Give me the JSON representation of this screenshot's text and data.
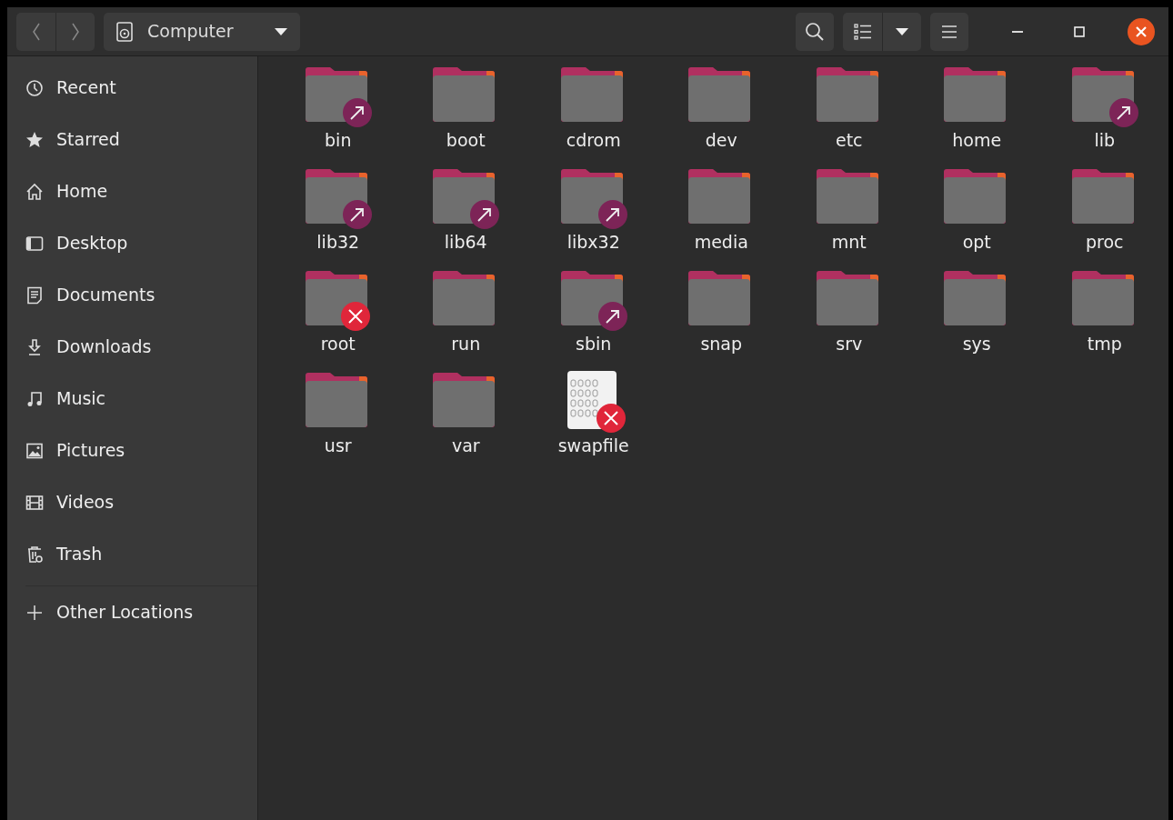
{
  "header": {
    "location": "Computer"
  },
  "sidebar": {
    "items": [
      {
        "label": "Recent",
        "selected": false
      },
      {
        "label": "Starred",
        "selected": false
      },
      {
        "label": "Home",
        "selected": false
      },
      {
        "label": "Desktop",
        "selected": false
      },
      {
        "label": "Documents",
        "selected": false
      },
      {
        "label": "Downloads",
        "selected": false
      },
      {
        "label": "Music",
        "selected": false
      },
      {
        "label": "Pictures",
        "selected": false
      },
      {
        "label": "Videos",
        "selected": false
      },
      {
        "label": "Trash",
        "selected": false
      }
    ],
    "other": {
      "label": "Other Locations"
    }
  },
  "files": [
    {
      "name": "bin",
      "kind": "folder",
      "symlink": true,
      "unreadable": false
    },
    {
      "name": "boot",
      "kind": "folder",
      "symlink": false,
      "unreadable": false
    },
    {
      "name": "cdrom",
      "kind": "folder",
      "symlink": false,
      "unreadable": false
    },
    {
      "name": "dev",
      "kind": "folder",
      "symlink": false,
      "unreadable": false
    },
    {
      "name": "etc",
      "kind": "folder",
      "symlink": false,
      "unreadable": false
    },
    {
      "name": "home",
      "kind": "folder",
      "symlink": false,
      "unreadable": false
    },
    {
      "name": "lib",
      "kind": "folder",
      "symlink": true,
      "unreadable": false
    },
    {
      "name": "lib32",
      "kind": "folder",
      "symlink": true,
      "unreadable": false
    },
    {
      "name": "lib64",
      "kind": "folder",
      "symlink": true,
      "unreadable": false
    },
    {
      "name": "libx32",
      "kind": "folder",
      "symlink": true,
      "unreadable": false
    },
    {
      "name": "media",
      "kind": "folder",
      "symlink": false,
      "unreadable": false
    },
    {
      "name": "mnt",
      "kind": "folder",
      "symlink": false,
      "unreadable": false
    },
    {
      "name": "opt",
      "kind": "folder",
      "symlink": false,
      "unreadable": false
    },
    {
      "name": "proc",
      "kind": "folder",
      "symlink": false,
      "unreadable": false
    },
    {
      "name": "root",
      "kind": "folder",
      "symlink": false,
      "unreadable": true
    },
    {
      "name": "run",
      "kind": "folder",
      "symlink": false,
      "unreadable": false
    },
    {
      "name": "sbin",
      "kind": "folder",
      "symlink": true,
      "unreadable": false
    },
    {
      "name": "snap",
      "kind": "folder",
      "symlink": false,
      "unreadable": false
    },
    {
      "name": "srv",
      "kind": "folder",
      "symlink": false,
      "unreadable": false
    },
    {
      "name": "sys",
      "kind": "folder",
      "symlink": false,
      "unreadable": false
    },
    {
      "name": "tmp",
      "kind": "folder",
      "symlink": false,
      "unreadable": false
    },
    {
      "name": "usr",
      "kind": "folder",
      "symlink": false,
      "unreadable": false
    },
    {
      "name": "var",
      "kind": "folder",
      "symlink": false,
      "unreadable": false
    },
    {
      "name": "swapfile",
      "kind": "binary",
      "symlink": false,
      "unreadable": true
    }
  ]
}
